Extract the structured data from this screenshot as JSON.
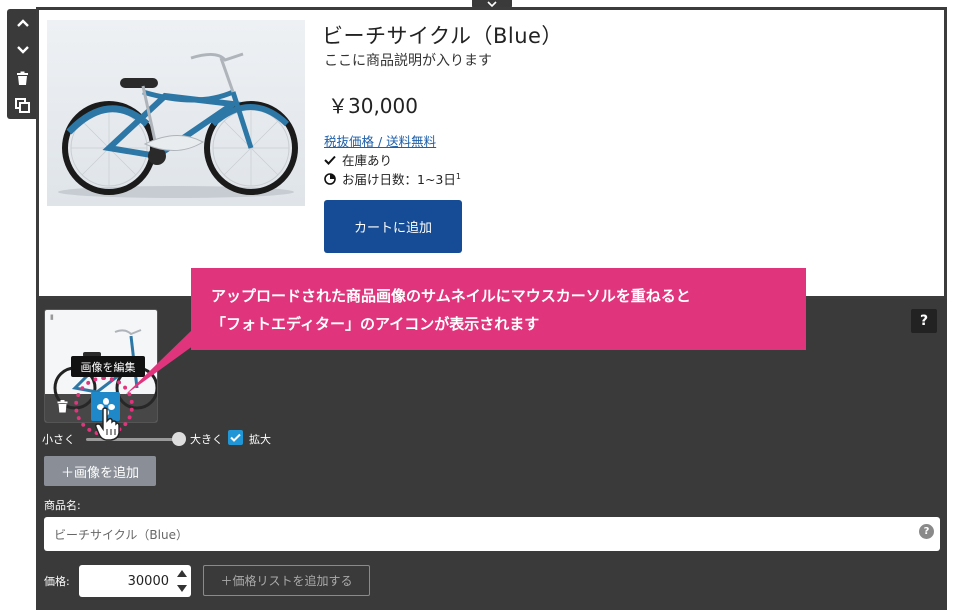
{
  "toolbar": {
    "icons": [
      "chevron-up-icon",
      "chevron-down-icon",
      "trash-icon",
      "copy-icon"
    ]
  },
  "product": {
    "title": "ビーチサイクル（Blue）",
    "description": "ここに商品説明が入ります",
    "price": "￥30,000",
    "tax_link": "税抜価格 / 送料無料",
    "stock": "在庫あり",
    "delivery": "お届け日数：1~3日",
    "delivery_note": "1",
    "cart_button": "カートに追加"
  },
  "editor": {
    "help": "?",
    "tooltip": "画像を編集",
    "size_small": "小さく",
    "size_large": "大きく",
    "zoom_label": "拡大",
    "zoom_checked": true,
    "add_image": "＋画像を追加",
    "name_label": "商品名:",
    "name_value": "ビーチサイクル（Blue）",
    "price_label": "価格:",
    "price_value": "30000",
    "add_price_list": "＋価格リストを追加する"
  },
  "callout": {
    "line1": "アップロードされた商品画像のサムネイルにマウスカーソルを重ねると",
    "line2": "「フォトエディター」のアイコンが表示されます"
  },
  "colors": {
    "accent": "#e0357d",
    "cart": "#154c95",
    "editor_bg": "#3a3a3a",
    "photo_editor": "#1e88c9"
  }
}
